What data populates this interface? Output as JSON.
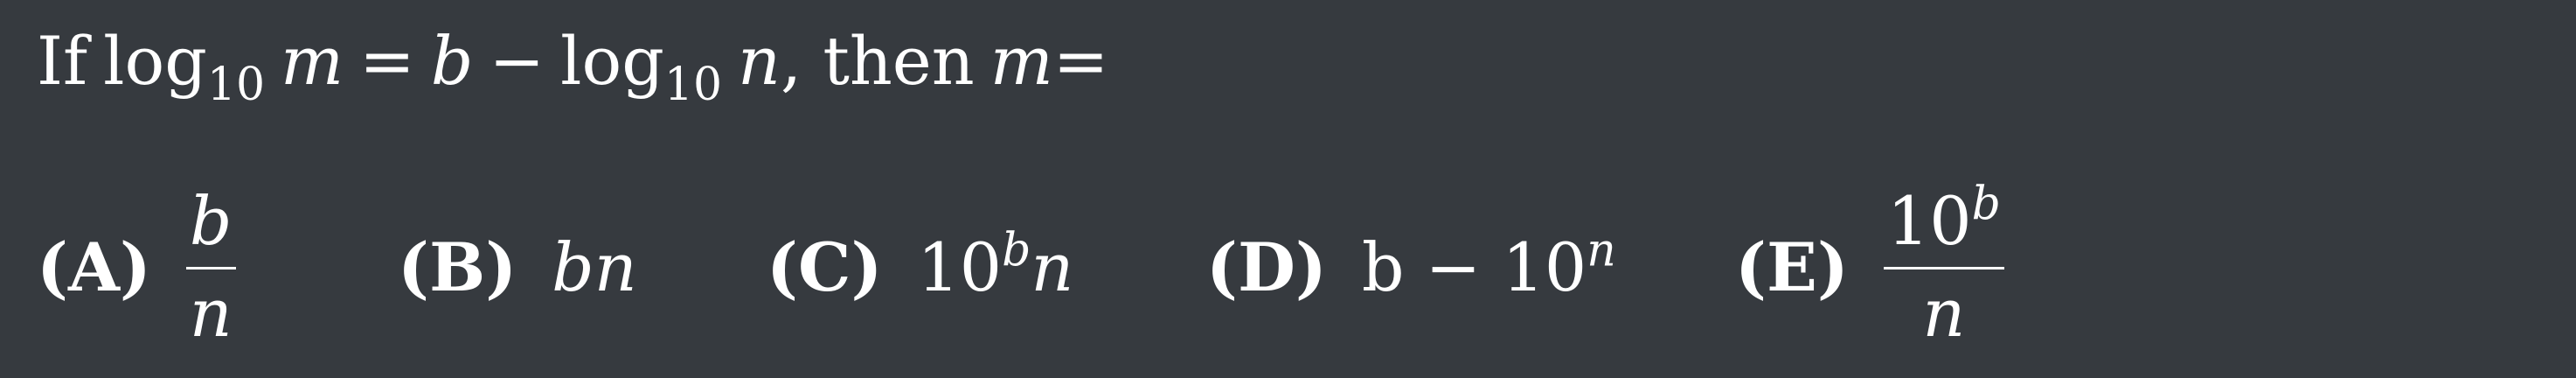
{
  "question": {
    "if": "If",
    "log": "log",
    "base": "10",
    "var_m": "m",
    "equals": "=",
    "var_b": "b",
    "minus": "−",
    "var_n": "n",
    "then": ", then",
    "end": "m="
  },
  "choices": [
    {
      "label": "(A)",
      "num": "b",
      "den": "n"
    },
    {
      "label": "(B)",
      "expr": "bn"
    },
    {
      "label": "(C)",
      "base": "10",
      "exp": "b",
      "tail": "n"
    },
    {
      "label": "(D)",
      "head": "b − 10",
      "exp": "n"
    },
    {
      "label": "(E)",
      "num_base": "10",
      "num_exp": "b",
      "den": "n"
    }
  ]
}
